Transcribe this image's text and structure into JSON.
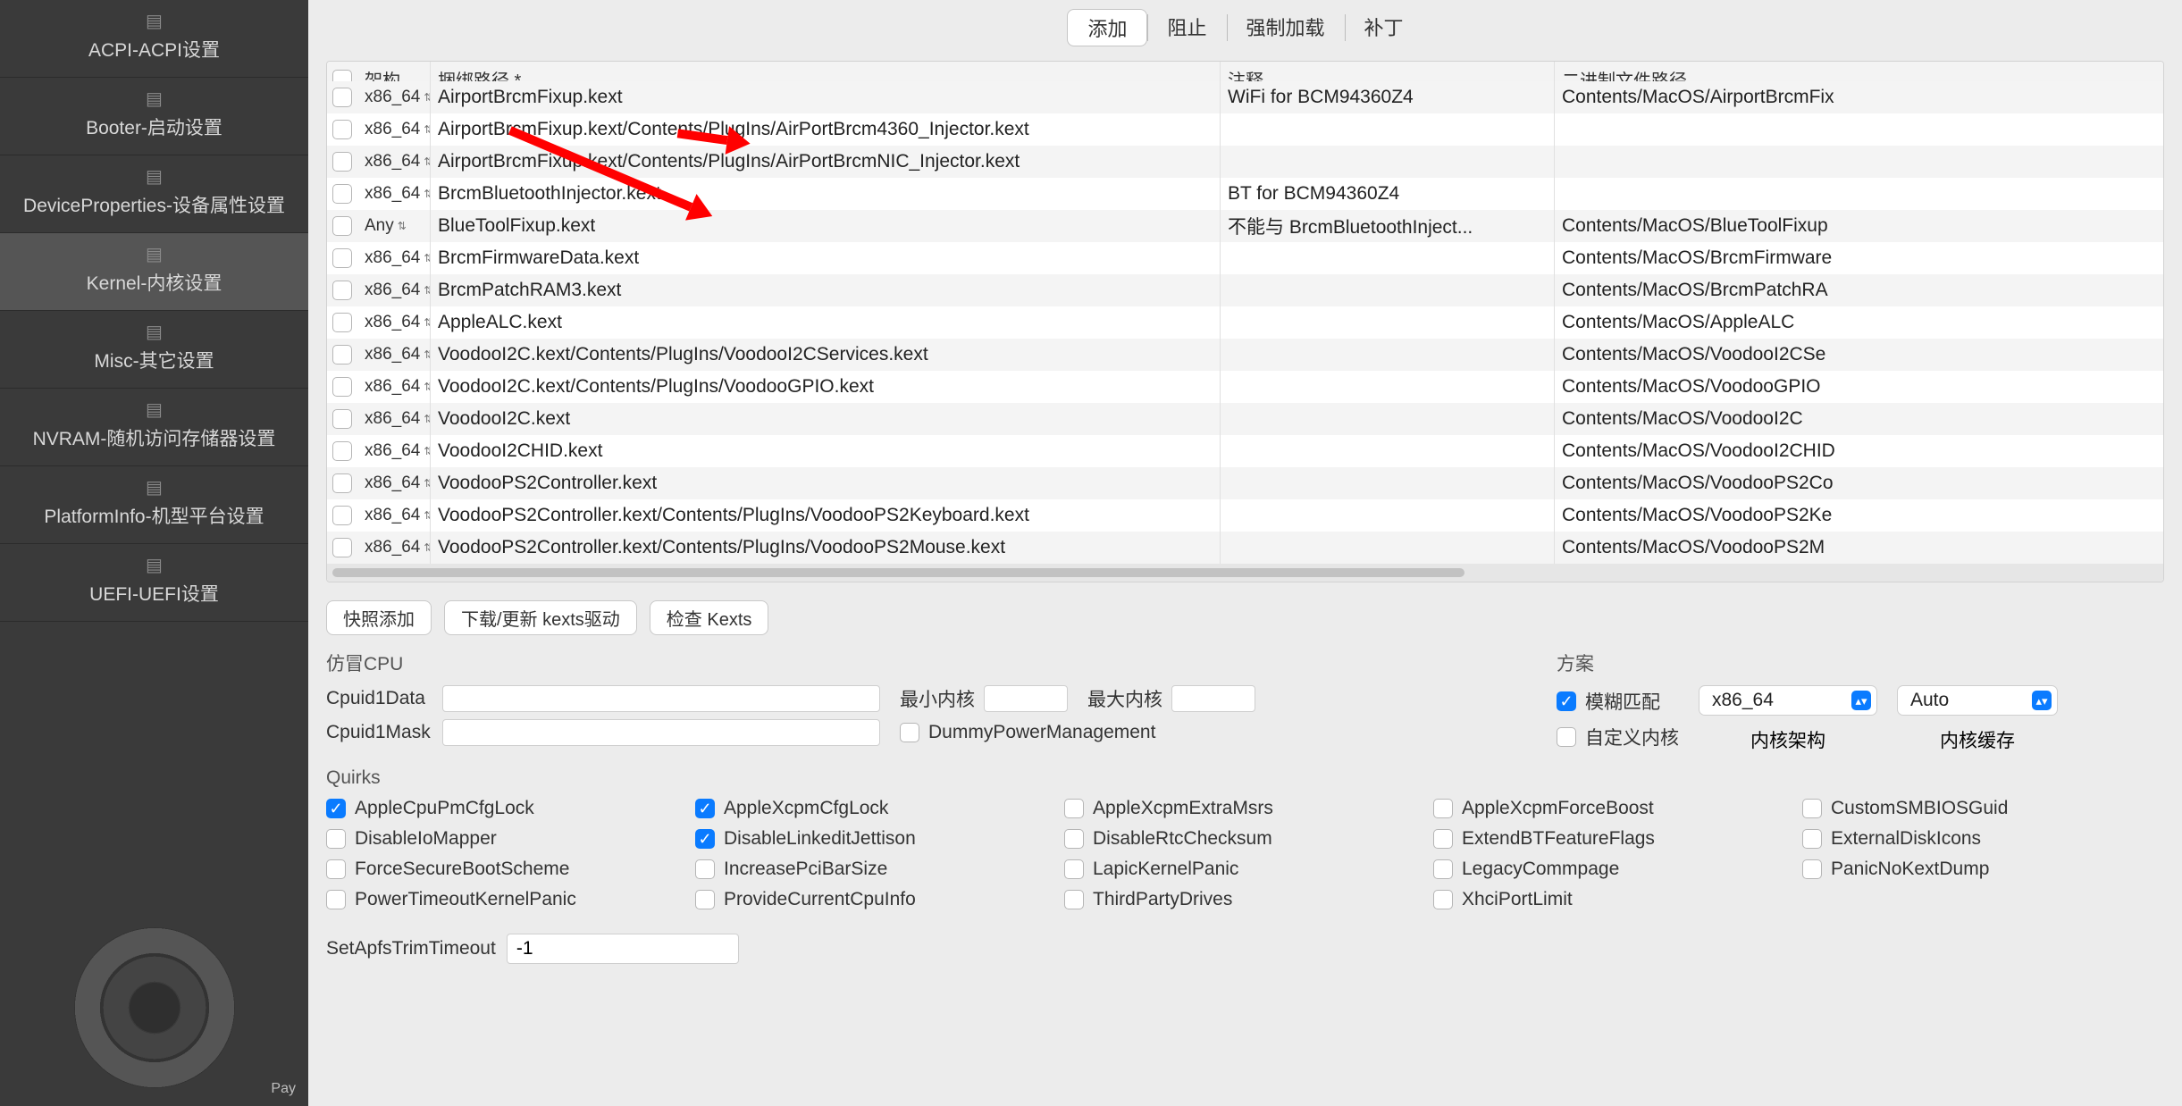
{
  "sidebar": {
    "items": [
      {
        "label": "ACPI-ACPI设置"
      },
      {
        "label": "Booter-启动设置"
      },
      {
        "label": "DeviceProperties-设备属性设置"
      },
      {
        "label": "Kernel-内核设置"
      },
      {
        "label": "Misc-其它设置"
      },
      {
        "label": "NVRAM-随机访问存储器设置"
      },
      {
        "label": "PlatformInfo-机型平台设置"
      },
      {
        "label": "UEFI-UEFI设置"
      }
    ],
    "pay": "Pay"
  },
  "tabs": [
    {
      "label": "添加"
    },
    {
      "label": "阻止"
    },
    {
      "label": "强制加载"
    },
    {
      "label": "补丁"
    }
  ],
  "columns": {
    "arch": "架构",
    "path": "捆绑路径 *",
    "note": "注释",
    "exec": "二进制文件路径"
  },
  "rows": [
    {
      "arch": "x86_64",
      "path": "AirportBrcmFixup.kext",
      "note": "WiFi for BCM94360Z4",
      "exec": "Contents/MacOS/AirportBrcmFix"
    },
    {
      "arch": "x86_64",
      "path": "AirportBrcmFixup.kext/Contents/PlugIns/AirPortBrcm4360_Injector.kext",
      "note": "",
      "exec": ""
    },
    {
      "arch": "x86_64",
      "path": "AirportBrcmFixup.kext/Contents/PlugIns/AirPortBrcmNIC_Injector.kext",
      "note": "",
      "exec": ""
    },
    {
      "arch": "x86_64",
      "path": "BrcmBluetoothInjector.kext",
      "note": "BT for BCM94360Z4",
      "exec": ""
    },
    {
      "arch": "Any",
      "path": "BlueToolFixup.kext",
      "note": "不能与 BrcmBluetoothInject...",
      "exec": "Contents/MacOS/BlueToolFixup"
    },
    {
      "arch": "x86_64",
      "path": "BrcmFirmwareData.kext",
      "note": "",
      "exec": "Contents/MacOS/BrcmFirmware"
    },
    {
      "arch": "x86_64",
      "path": "BrcmPatchRAM3.kext",
      "note": "",
      "exec": "Contents/MacOS/BrcmPatchRA"
    },
    {
      "arch": "x86_64",
      "path": "AppleALC.kext",
      "note": "",
      "exec": "Contents/MacOS/AppleALC"
    },
    {
      "arch": "x86_64",
      "path": "VoodooI2C.kext/Contents/PlugIns/VoodooI2CServices.kext",
      "note": "",
      "exec": "Contents/MacOS/VoodooI2CSe"
    },
    {
      "arch": "x86_64",
      "path": "VoodooI2C.kext/Contents/PlugIns/VoodooGPIO.kext",
      "note": "",
      "exec": "Contents/MacOS/VoodooGPIO"
    },
    {
      "arch": "x86_64",
      "path": "VoodooI2C.kext",
      "note": "",
      "exec": "Contents/MacOS/VoodooI2C"
    },
    {
      "arch": "x86_64",
      "path": "VoodooI2CHID.kext",
      "note": "",
      "exec": "Contents/MacOS/VoodooI2CHID"
    },
    {
      "arch": "x86_64",
      "path": "VoodooPS2Controller.kext",
      "note": "",
      "exec": "Contents/MacOS/VoodooPS2Co"
    },
    {
      "arch": "x86_64",
      "path": "VoodooPS2Controller.kext/Contents/PlugIns/VoodooPS2Keyboard.kext",
      "note": "",
      "exec": "Contents/MacOS/VoodooPS2Ke"
    },
    {
      "arch": "x86_64",
      "path": "VoodooPS2Controller.kext/Contents/PlugIns/VoodooPS2Mouse.kext",
      "note": "",
      "exec": "Contents/MacOS/VoodooPS2M"
    }
  ],
  "buttons": {
    "snapshot": "快照添加",
    "download": "下载/更新 kexts驱动",
    "check": "检查 Kexts"
  },
  "cpu": {
    "title": "仿冒CPU",
    "cpuid1data": "Cpuid1Data",
    "cpuid1mask": "Cpuid1Mask",
    "minkernel": "最小内核",
    "maxkernel": "最大内核",
    "dummy": "DummyPowerManagement"
  },
  "scheme": {
    "title": "方案",
    "fuzzy": "模糊匹配",
    "custom": "自定义内核",
    "arch_select": "x86_64",
    "arch_label": "内核架构",
    "cache_select": "Auto",
    "cache_label": "内核缓存"
  },
  "quirks": {
    "title": "Quirks",
    "list": [
      {
        "label": "AppleCpuPmCfgLock",
        "on": true
      },
      {
        "label": "AppleXcpmCfgLock",
        "on": true
      },
      {
        "label": "AppleXcpmExtraMsrs",
        "on": false
      },
      {
        "label": "AppleXcpmForceBoost",
        "on": false
      },
      {
        "label": "CustomSMBIOSGuid",
        "on": false
      },
      {
        "label": "DisableIoMapper",
        "on": false
      },
      {
        "label": "DisableLinkeditJettison",
        "on": true
      },
      {
        "label": "DisableRtcChecksum",
        "on": false
      },
      {
        "label": "ExtendBTFeatureFlags",
        "on": false
      },
      {
        "label": "ExternalDiskIcons",
        "on": false
      },
      {
        "label": "ForceSecureBootScheme",
        "on": false
      },
      {
        "label": "IncreasePciBarSize",
        "on": false
      },
      {
        "label": "LapicKernelPanic",
        "on": false
      },
      {
        "label": "LegacyCommpage",
        "on": false
      },
      {
        "label": "PanicNoKextDump",
        "on": false
      },
      {
        "label": "PowerTimeoutKernelPanic",
        "on": false
      },
      {
        "label": "ProvideCurrentCpuInfo",
        "on": false
      },
      {
        "label": "ThirdPartyDrives",
        "on": false
      },
      {
        "label": "XhciPortLimit",
        "on": false
      }
    ]
  },
  "apfs": {
    "label": "SetApfsTrimTimeout",
    "value": "-1"
  }
}
